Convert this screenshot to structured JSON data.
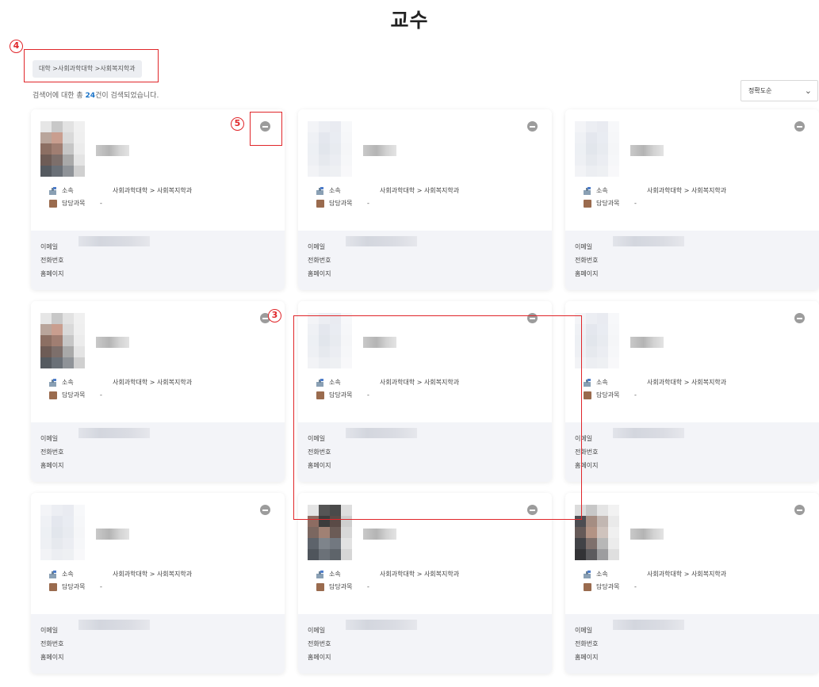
{
  "page": {
    "title": "교수"
  },
  "breadcrumb": {
    "text": "대학 >사회과학대학 >사회복지학과"
  },
  "results": {
    "prefix": "검색어에 대한 총 ",
    "count": "24",
    "suffix": "건이 검색되었습니다."
  },
  "sort": {
    "selected": "정확도순"
  },
  "card_labels": {
    "affiliation": "소속",
    "subject": "담당과목",
    "email": "이메일",
    "phone": "전화번호",
    "homepage": "홈페이지"
  },
  "professors": [
    {
      "affiliation": "사회과학대학 > 사회복지학과",
      "subject": "-",
      "photo": "face"
    },
    {
      "affiliation": "사회과학대학 > 사회복지학과",
      "subject": "-",
      "photo": "blank"
    },
    {
      "affiliation": "사회과학대학 > 사회복지학과",
      "subject": "-",
      "photo": "blank"
    },
    {
      "affiliation": "사회과학대학 > 사회복지학과",
      "subject": "-",
      "photo": "face"
    },
    {
      "affiliation": "사회과학대학 > 사회복지학과",
      "subject": "-",
      "photo": "blank"
    },
    {
      "affiliation": "사회과학대학 > 사회복지학과",
      "subject": "-",
      "photo": "blank"
    },
    {
      "affiliation": "사회과학대학 > 사회복지학과",
      "subject": "-",
      "photo": "blank"
    },
    {
      "affiliation": "사회과학대학 > 사회복지학과",
      "subject": "-",
      "photo": "dark"
    },
    {
      "affiliation": "사회과학대학 > 사회복지학과",
      "subject": "-",
      "photo": "face2"
    }
  ],
  "annotations": {
    "breadcrumb": "4",
    "remove": "5",
    "card": "3"
  },
  "colors": {
    "accent": "#1a73c8",
    "annotation": "#e0262a",
    "remove_icon": "#9c9c9c"
  }
}
